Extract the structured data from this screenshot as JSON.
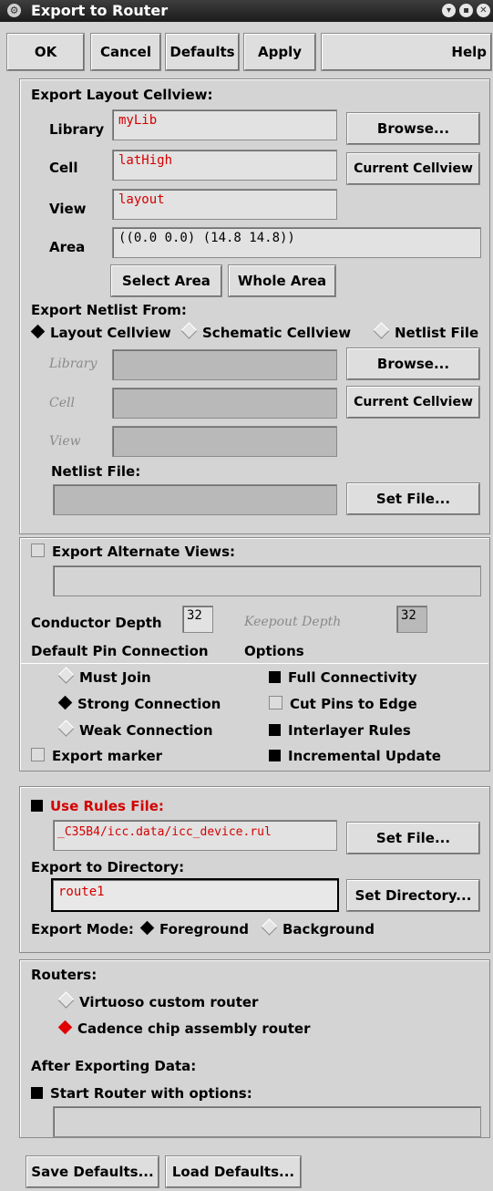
{
  "window": {
    "title": "Export to Router"
  },
  "buttons": {
    "ok": "OK",
    "cancel": "Cancel",
    "defaults": "Defaults",
    "apply": "Apply",
    "help": "Help"
  },
  "layout_section": {
    "heading": "Export Layout Cellview:",
    "library_label": "Library",
    "library_value": "myLib",
    "cell_label": "Cell",
    "cell_value": "latHigh",
    "view_label": "View",
    "view_value": "layout",
    "area_label": "Area",
    "area_value": "((0.0 0.0) (14.8 14.8))",
    "browse": "Browse...",
    "current_cellview": "Current Cellview",
    "select_area": "Select Area",
    "whole_area": "Whole Area"
  },
  "netlist_section": {
    "heading": "Export Netlist From:",
    "options": [
      "Layout Cellview",
      "Schematic Cellview",
      "Netlist File"
    ],
    "selected": "Layout Cellview",
    "library_label": "Library",
    "cell_label": "Cell",
    "view_label": "View",
    "browse": "Browse...",
    "current_cellview": "Current Cellview",
    "netlist_file_label": "Netlist File:",
    "set_file": "Set File..."
  },
  "alternate_section": {
    "export_alternate_views": "Export Alternate Views:",
    "conductor_depth_label": "Conductor Depth",
    "conductor_depth_value": "32",
    "keepout_depth_label": "Keepout Depth",
    "keepout_depth_value": "32",
    "default_pin_connection": "Default Pin Connection",
    "options_label": "Options",
    "pin_options": [
      "Must Join",
      "Strong Connection",
      "Weak Connection"
    ],
    "pin_selected": "Strong Connection",
    "export_marker": "Export marker",
    "checkboxes": [
      {
        "label": "Full Connectivity",
        "checked": true
      },
      {
        "label": "Cut Pins to Edge",
        "checked": false
      },
      {
        "label": "Interlayer Rules",
        "checked": true
      },
      {
        "label": "Incremental Update",
        "checked": true
      }
    ]
  },
  "rules_section": {
    "use_rules_file": "Use Rules File:",
    "rules_file_value": "_C35B4/icc.data/icc_device.rul",
    "set_file": "Set File...",
    "export_dir_label": "Export to Directory:",
    "export_dir_value": "route1",
    "set_directory": "Set Directory...",
    "export_mode_label": "Export Mode:",
    "mode_options": [
      "Foreground",
      "Background"
    ],
    "mode_selected": "Foreground"
  },
  "routers_section": {
    "heading": "Routers:",
    "options": [
      "Virtuoso custom router",
      "Cadence chip assembly router"
    ],
    "selected": "Cadence chip assembly router",
    "after_export": "After Exporting Data:",
    "start_router": "Start Router with options:"
  },
  "bottom": {
    "save_defaults": "Save Defaults...",
    "load_defaults": "Load Defaults..."
  }
}
